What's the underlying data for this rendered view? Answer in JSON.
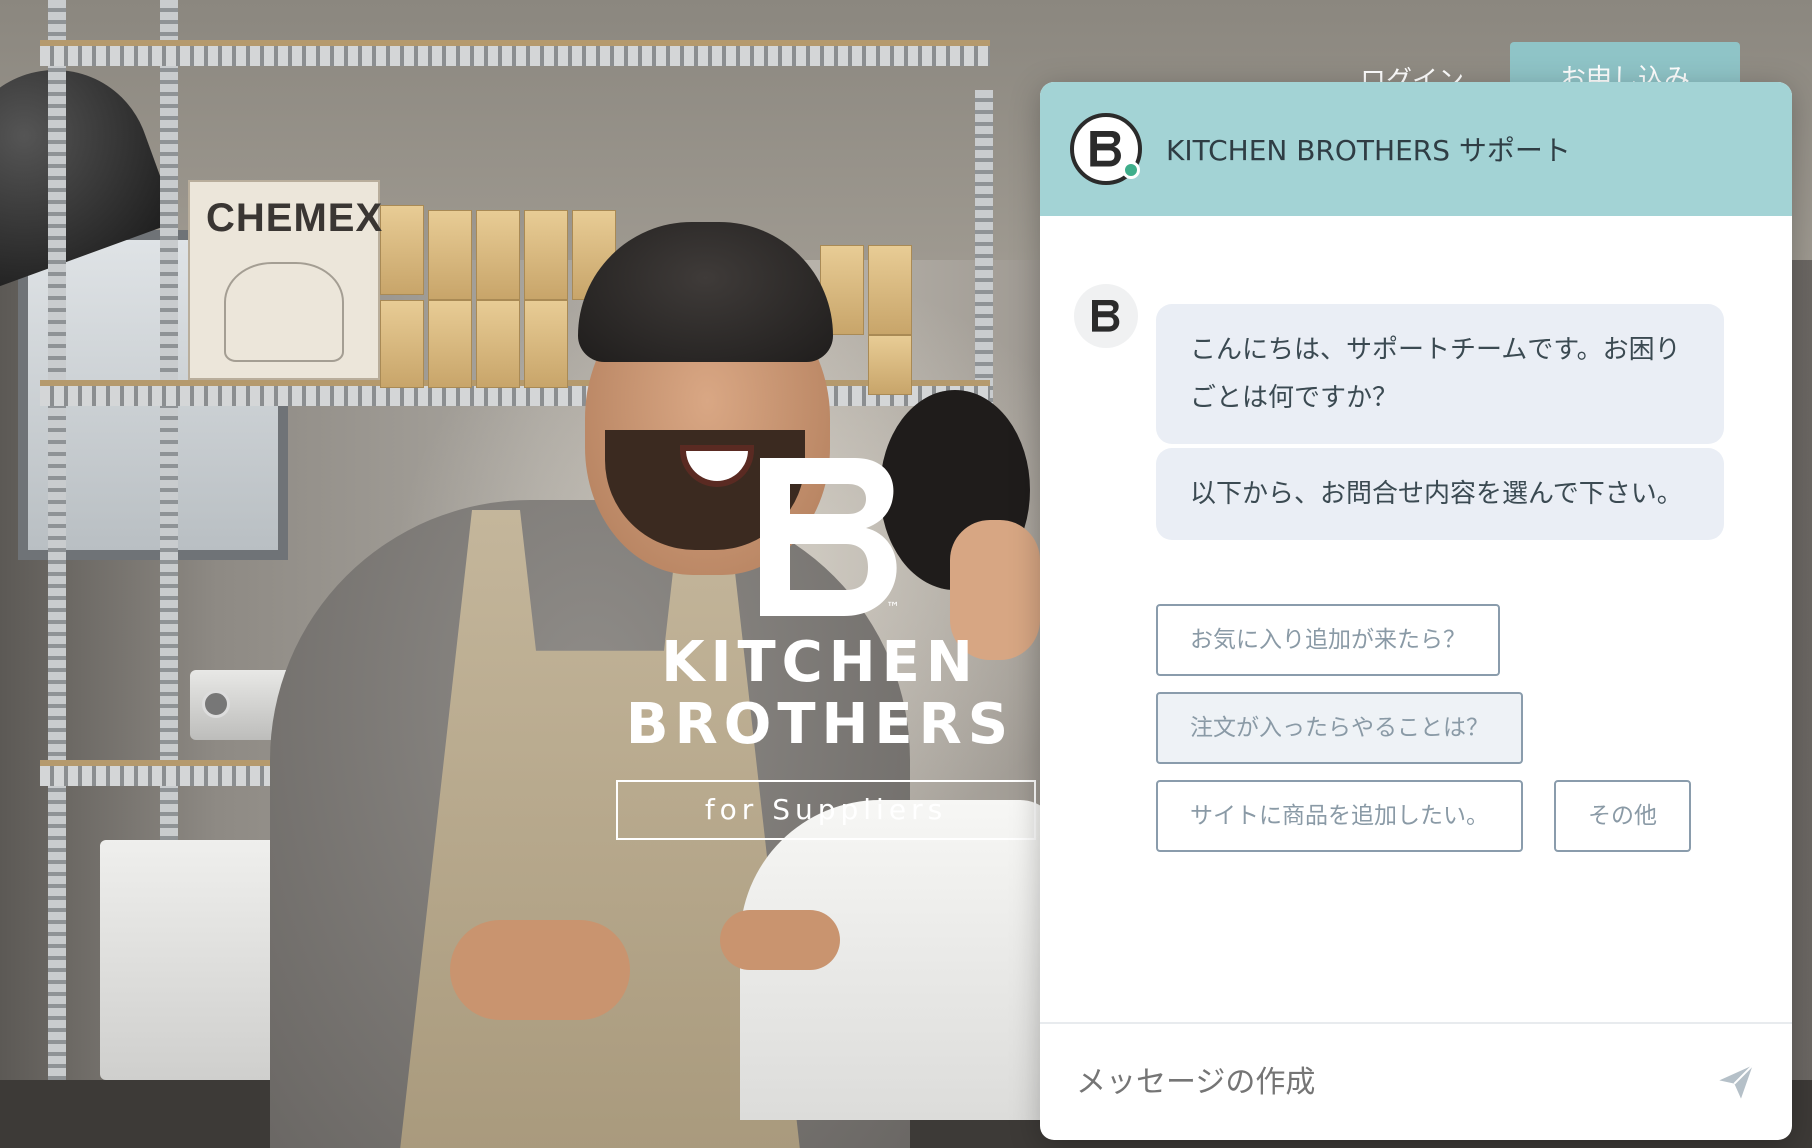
{
  "site": {
    "nav": {
      "login": "ログイン",
      "apply": "お申し込み"
    },
    "hero": {
      "logo_line1": "KITCHEN",
      "logo_line2": "BROTHERS",
      "trademark": "™",
      "tagline": "for Suppliers",
      "photo_sign": "CHEMEX"
    }
  },
  "chat": {
    "title": "KITCHEN BROTHERS サポート",
    "status_color": "#3fae8b",
    "header_color": "#a3d3d5",
    "messages": [
      "こんにちは、サポートチームです。お困りごとは何ですか？",
      "以下から、お問合せ内容を選んで下さい。"
    ],
    "choices": [
      "お気に入り追加が来たら？",
      "注文が入ったらやることは？",
      "サイトに商品を追加したい。",
      "その他"
    ],
    "composer_placeholder": "メッセージの作成",
    "send_icon": "send-icon"
  }
}
